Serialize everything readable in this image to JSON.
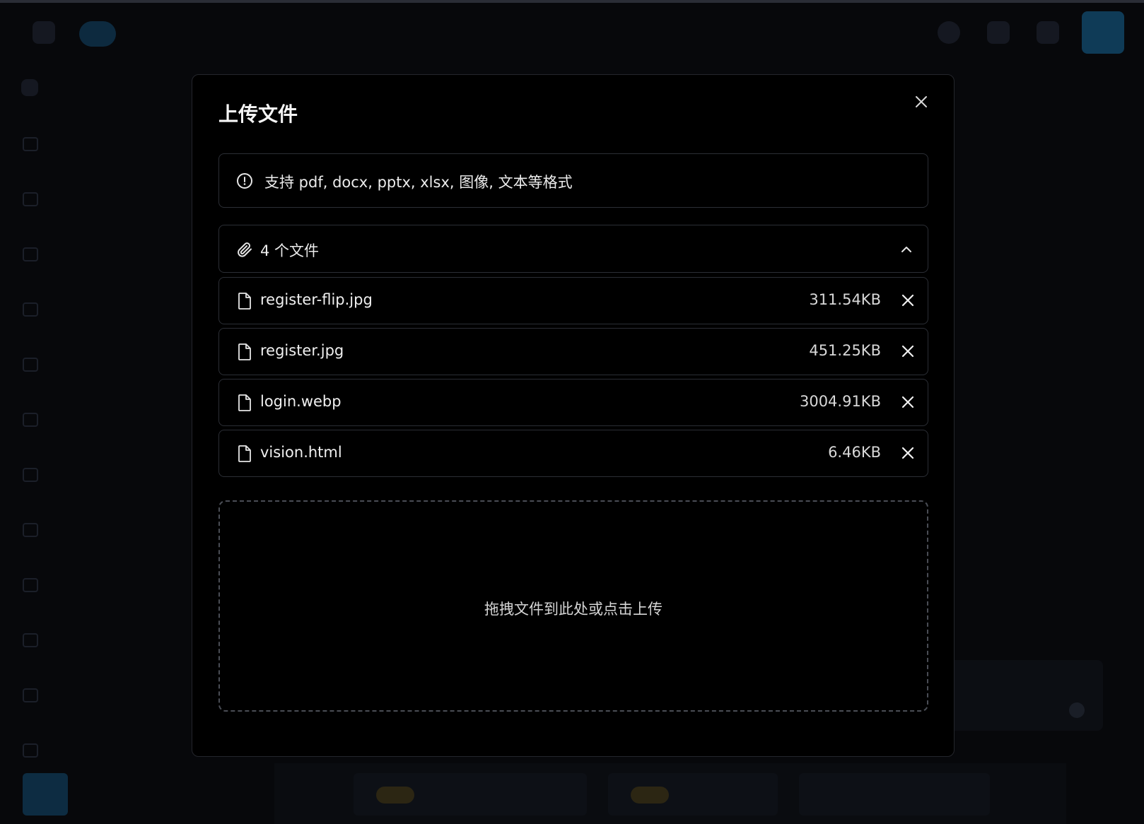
{
  "modal": {
    "title": "上传文件",
    "info_text": "支持 pdf, docx, pptx, xlsx, 图像, 文本等格式",
    "files_header": "4 个文件",
    "files": [
      {
        "name": "register-flip.jpg",
        "size": "311.54KB"
      },
      {
        "name": "register.jpg",
        "size": "451.25KB"
      },
      {
        "name": "login.webp",
        "size": "3004.91KB"
      },
      {
        "name": "vision.html",
        "size": "6.46KB"
      }
    ],
    "dropzone_text": "拖拽文件到此处或点击上传"
  },
  "icons": {
    "close": "close-icon",
    "info": "info-circle-icon",
    "attachment": "paperclip-icon",
    "collapse": "chevron-up-icon",
    "file": "file-icon",
    "remove": "x-icon"
  },
  "colors": {
    "overlay": "#050608",
    "modal_bg": "#000000",
    "border": "#2b2e35",
    "text": "#ececec",
    "accent": "#0f3b57"
  }
}
